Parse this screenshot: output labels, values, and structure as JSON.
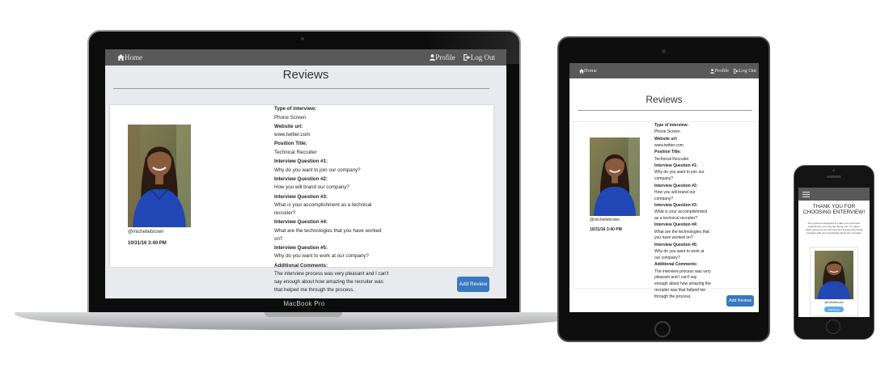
{
  "app": {
    "nav": {
      "home": "Home",
      "profile": "Profile",
      "logout": "Log Out"
    },
    "page_title": "Reviews",
    "review": {
      "username": "@michellebrown",
      "date": "10/31/16 3:40 PM",
      "fields": [
        {
          "label": "Type of interview:",
          "value": "Phone Screen"
        },
        {
          "label": "Website url:",
          "value": "www.twitter.com"
        },
        {
          "label": "Position Title:",
          "value": "Technical Recruiter"
        },
        {
          "label": "Interview Question #1:",
          "value": "Why do you want to join our company?"
        },
        {
          "label": "Interview Question #2:",
          "value": "How you will brand our company?"
        },
        {
          "label": "Interview Question #3:",
          "value": "What is your accomplishment as a technical recruiter?"
        },
        {
          "label": "Interview Question #4:",
          "value": "What are the technologies that you have worked on?"
        },
        {
          "label": "Interview Question #5:",
          "value": "Why do you want to work at our company?"
        },
        {
          "label": "Additional Comments:",
          "value": "The interview process was very pleasant and I can't say enough about how amazing the recruiter was that helped me through the process."
        }
      ]
    },
    "add_review": "Add Review"
  },
  "devices": {
    "laptop_label": "MacBook Pro"
  },
  "phone_app": {
    "heading": "THANK YOU FOR CHOOSING ENTERVIEW!",
    "body": "Our system is designed to make you more than prepared for your big day. Bring your \"A\" game when going into an interview and impress the hiring manager with your knowledge about the company.",
    "username": "@michellebrown",
    "button": "Add Photo"
  },
  "colors": {
    "nav_bg": "#595959",
    "button_blue": "#3879c0",
    "page_bg": "#e8eaed"
  }
}
